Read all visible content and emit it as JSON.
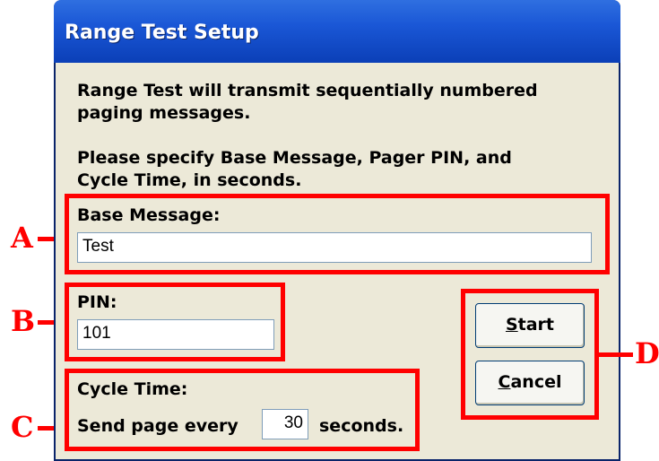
{
  "dialog": {
    "title": "Range Test Setup",
    "intro_line1": "Range Test will transmit sequentially numbered",
    "intro_line2": "paging messages.",
    "instr_line1": "Please specify Base Message, Pager PIN, and",
    "instr_line2": "Cycle Time, in seconds."
  },
  "fields": {
    "base_message": {
      "label": "Base Message:",
      "value": "Test"
    },
    "pin": {
      "label": "PIN:",
      "value": "101"
    },
    "cycle_time": {
      "label": "Cycle Time:",
      "prefix": "Send page every",
      "value": "30",
      "suffix": "seconds."
    }
  },
  "buttons": {
    "start": {
      "mnemonic": "S",
      "rest": "tart"
    },
    "cancel": {
      "mnemonic": "C",
      "rest": "ancel"
    }
  },
  "callouts": {
    "a": "A",
    "b": "B",
    "c": "C",
    "d": "D"
  },
  "colors": {
    "titlebar": "#0b3fb7",
    "dialog_bg": "#ece9d8",
    "annotation": "#ff0000"
  }
}
